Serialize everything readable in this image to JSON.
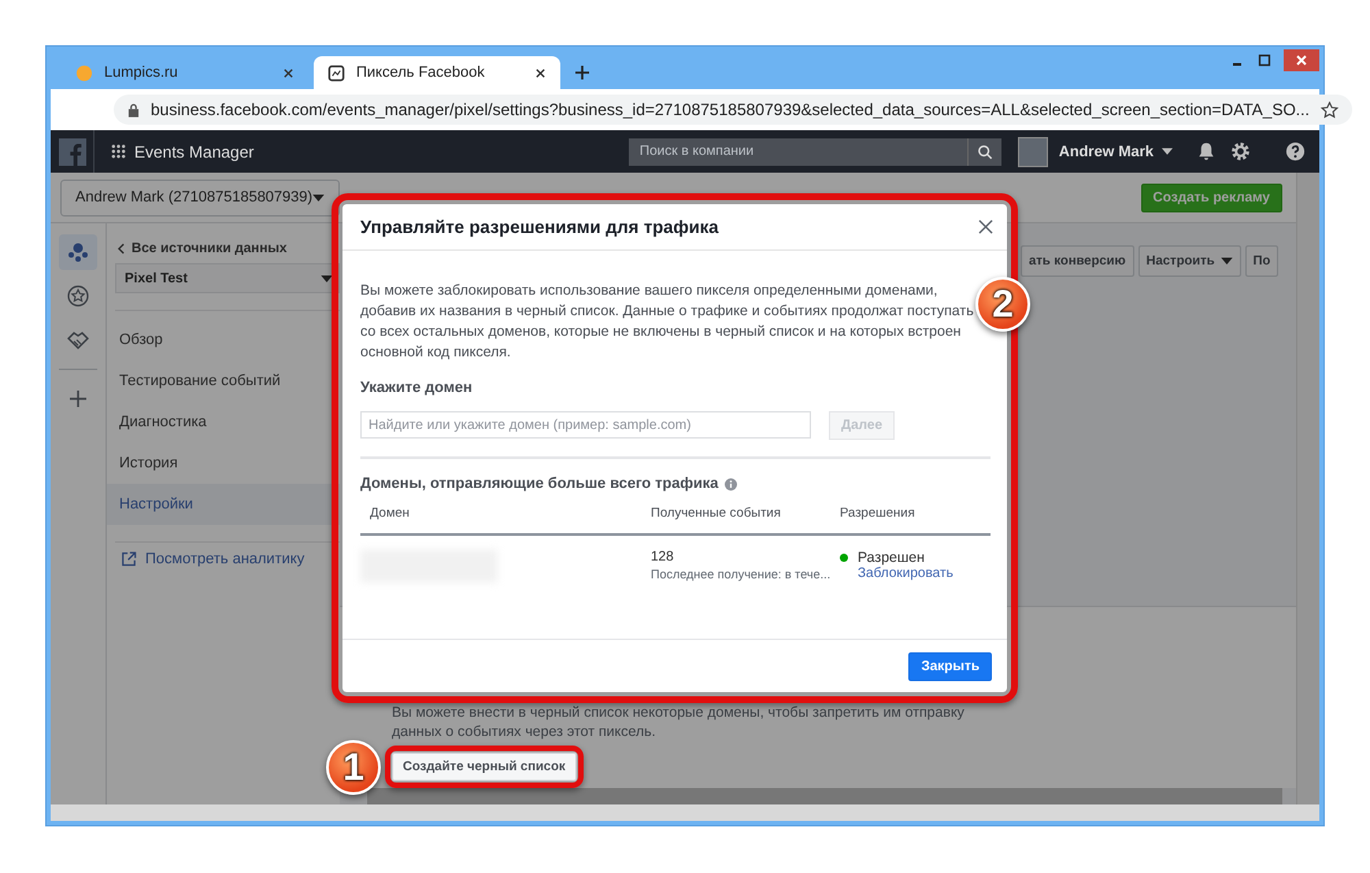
{
  "browser": {
    "tabs": [
      {
        "title": "Lumpics.ru",
        "selected": false
      },
      {
        "title": "Пиксель Facebook",
        "selected": true
      }
    ],
    "url": "business.facebook.com/events_manager/pixel/settings?business_id=2710875185807939&selected_data_sources=ALL&selected_screen_section=DATA_SO..."
  },
  "top_bar": {
    "app_name": "Events Manager",
    "search_placeholder": "Поиск в компании",
    "user_name": "Andrew Mark"
  },
  "account_selector": "Andrew Mark (2710875185807939)",
  "create_ad_button": "Создать рекламу",
  "rail_items": [
    {
      "kind": "people",
      "selected": true
    },
    {
      "kind": "star",
      "selected": false
    },
    {
      "kind": "handshake",
      "selected": false
    },
    {
      "kind": "plus",
      "selected": false
    }
  ],
  "sidebar": {
    "back_link": "Все источники данных",
    "source_selector": "Pixel Test",
    "items": [
      {
        "label": "Обзор",
        "selected": false
      },
      {
        "label": "Тестирование событий",
        "selected": false
      },
      {
        "label": "Диагностика",
        "selected": false
      },
      {
        "label": "История",
        "selected": false
      },
      {
        "label": "Настройки",
        "selected": true
      }
    ],
    "analytics_link": "Посмотреть аналитику"
  },
  "toolbar": [
    {
      "label": "ать конверсию",
      "dropdown": false
    },
    {
      "label": "Настроить",
      "dropdown": true
    },
    {
      "label": "По",
      "dropdown": false
    }
  ],
  "blacklist_section": {
    "description": "Вы можете внести в черный список некоторые домены, чтобы запретить им отправку данных о событиях через этот пиксель.",
    "button": "Создайте черный список"
  },
  "dialog": {
    "title": "Управляйте разрешениями для трафика",
    "description": "Вы можете заблокировать использование вашего пикселя определенными доменами, добавив их названия в черный список. Данные о трафике и событиях продолжат поступать со всех остальных доменов, которые не включены в черный список и на которых встроен основной код пикселя.",
    "domain_label": "Укажите домен",
    "domain_placeholder": "Найдите или укажите домен (пример: sample.com)",
    "next_button": "Далее",
    "table_title": "Домены, отправляющие больше всего трафика",
    "columns": [
      "Домен",
      "Полученные события",
      "Разрешения"
    ],
    "rows": [
      {
        "events": "128",
        "last_received": "Последнее получение: в тече...",
        "status": "Разрешен",
        "action": "Заблокировать"
      }
    ],
    "close_button": "Закрыть"
  },
  "annotations": [
    "1",
    "2"
  ]
}
